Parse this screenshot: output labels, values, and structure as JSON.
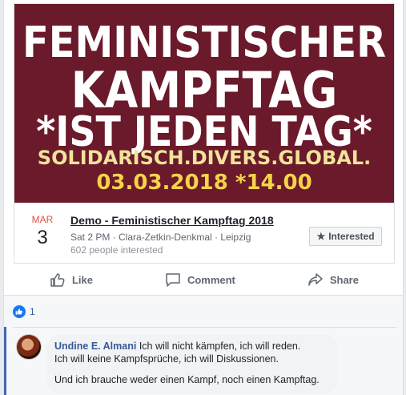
{
  "banner": {
    "line1": "FEMINISTISCHER",
    "line2": "KAMPFTAG",
    "line3": "*IST JEDEN TAG*",
    "line4": "SOLIDARISCH.DIVERS.GLOBAL.",
    "line5": "03.03.2018 *14.00"
  },
  "event": {
    "month": "MAR",
    "day": "3",
    "title": "Demo - Feministischer Kampftag 2018",
    "meta": "Sat 2 PM · Clara-Zetkin-Denkmal · Leipzig",
    "interested_count": "602 people interested",
    "interested_button": "Interested",
    "interested_icon": "star-icon"
  },
  "actions": {
    "like": "Like",
    "comment": "Comment",
    "share": "Share"
  },
  "reactions": {
    "count": "1",
    "icon": "thumbs-up-icon"
  },
  "comment": {
    "author": "Undine E. Almani",
    "line1": "Ich will nicht kämpfen, ich will reden.",
    "line2": "Ich will keine Kampfsprüche, ich will Diskussionen.",
    "line3": "Und ich brauche weder einen Kampf, noch einen Kampftag."
  },
  "colors": {
    "banner_bg": "#6a1a2a",
    "accent": "#1877f2",
    "link": "#385898"
  }
}
